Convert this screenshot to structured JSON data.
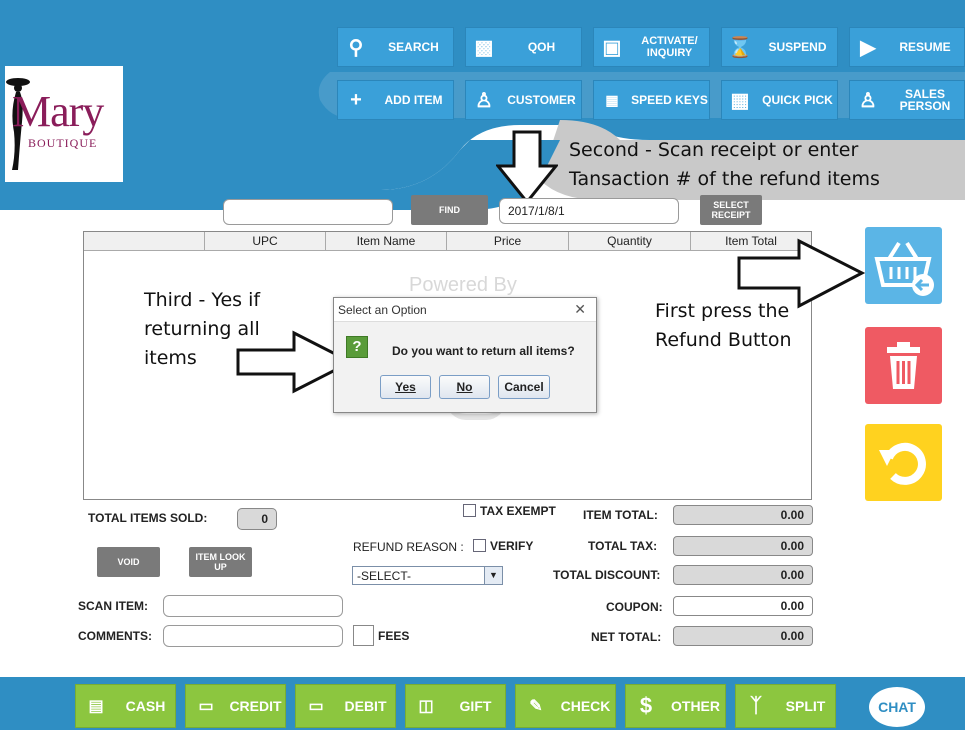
{
  "brand": {
    "logo_main": "Mary",
    "logo_sub": "BOUTIQUE"
  },
  "toolbar_top": [
    {
      "label": "SEARCH",
      "icon": "search-icon"
    },
    {
      "label": "QOH",
      "icon": "bar-chart-icon"
    },
    {
      "label": "ACTIVATE/ INQUIRY",
      "icon": "card-icon"
    },
    {
      "label": "SUSPEND",
      "icon": "hourglass-icon"
    },
    {
      "label": "RESUME",
      "icon": "play-icon"
    }
  ],
  "toolbar_bottom": [
    {
      "label": "ADD ITEM",
      "icon": "plus-icon"
    },
    {
      "label": "CUSTOMER",
      "icon": "add-person-icon"
    },
    {
      "label": "SPEED KEYS",
      "icon": "keypad-icon"
    },
    {
      "label": "QUICK PICK",
      "icon": "grid-icon"
    },
    {
      "label": "SALES PERSON",
      "icon": "salesperson-icon"
    }
  ],
  "annotations": {
    "second_line1": "Second - Scan receipt or enter",
    "second_line2": "Tansaction # of the refund items",
    "first_line1": "First press the",
    "first_line2": "Refund Button",
    "third_line1": "Third - Yes if",
    "third_line2": "returning all",
    "third_line3": "items"
  },
  "receipt": {
    "find_label": "FIND",
    "transaction_value": "2017/1/8/1",
    "select_receipt_label": "SELECT RECEIPT"
  },
  "table": {
    "columns": [
      "",
      "UPC",
      "Item Name",
      "Price",
      "Quantity",
      "Item Total"
    ],
    "watermark": "Powered By"
  },
  "dialog": {
    "title": "Select an Option",
    "message": "Do you want to return all items?",
    "yes": "Yes",
    "no": "No",
    "cancel": "Cancel"
  },
  "summary": {
    "total_items_label": "TOTAL ITEMS SOLD:",
    "total_items_value": "0",
    "void_label": "VOID",
    "item_lookup_label": "ITEM LOOK UP",
    "tax_exempt_label": "TAX EXEMPT",
    "refund_reason_label": "REFUND REASON :",
    "verify_label": "VERIFY",
    "refund_reason_value": "-SELECT-",
    "scan_item_label": "SCAN ITEM:",
    "comments_label": "COMMENTS:",
    "fees_label": "FEES",
    "item_total_label": "ITEM TOTAL:",
    "item_total_value": "0.00",
    "total_tax_label": "TOTAL TAX:",
    "total_tax_value": "0.00",
    "total_discount_label": "TOTAL DISCOUNT:",
    "total_discount_value": "0.00",
    "coupon_label": "COUPON:",
    "coupon_value": "0.00",
    "net_total_label": "NET TOTAL:",
    "net_total_value": "0.00"
  },
  "payments": [
    {
      "label": "CASH",
      "icon": "cash-icon"
    },
    {
      "label": "CREDIT",
      "icon": "credit-card-icon"
    },
    {
      "label": "DEBIT",
      "icon": "debit-card-icon"
    },
    {
      "label": "GIFT",
      "icon": "gift-icon"
    },
    {
      "label": "CHECK",
      "icon": "check-icon"
    },
    {
      "label": "OTHER",
      "icon": "dollar-icon"
    },
    {
      "label": "SPLIT",
      "icon": "split-icon"
    }
  ],
  "chat_label": "CHAT",
  "colors": {
    "accent_blue": "#3aa0d9",
    "banner_blue": "#2f8ec3",
    "refund_blue": "#5bb5e6",
    "delete_red": "#ef5a63",
    "undo_yellow": "#ffd21f",
    "pay_green": "#8cc63f"
  }
}
